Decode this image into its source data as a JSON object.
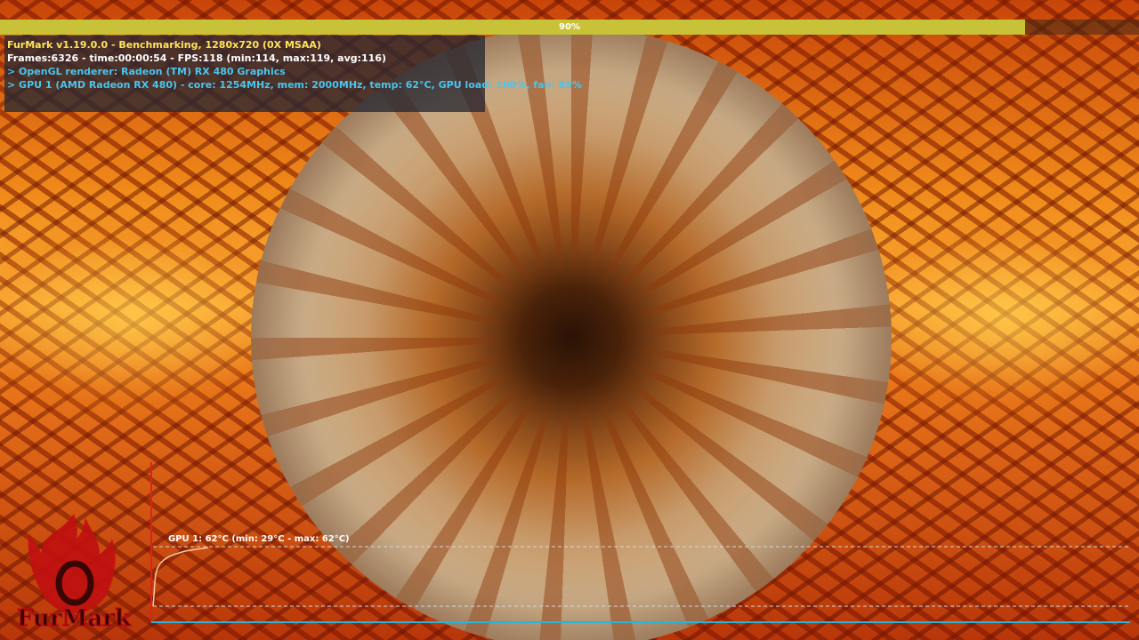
{
  "progress": {
    "label": "90%",
    "percent": 90,
    "fill_color": "#c8c238"
  },
  "info": {
    "title": "FurMark v1.19.0.0 - Benchmarking, 1280x720 (0X MSAA)",
    "frames": "Frames:6326 - time:00:00:54 - FPS:118 (min:114, max:119, avg:116)",
    "renderer": "> OpenGL renderer: Radeon (TM) RX 480 Graphics",
    "gpu": "> GPU 1 (AMD Radeon RX 480) - core: 1254MHz, mem: 2000MHz, temp: 62°C, GPU load: 100%, fan: 85%",
    "title_color": "#ffe35a",
    "detail_color": "#49c6ee"
  },
  "temp_graph": {
    "label": "GPU 1: 62°C (min: 29°C - max: 62°C)",
    "min_c": 29,
    "max_c": 62,
    "current_c": 62,
    "line_color": "#f5c8a0",
    "axis_color": "#2cb4d8"
  },
  "logo": {
    "text": "FurMark"
  }
}
